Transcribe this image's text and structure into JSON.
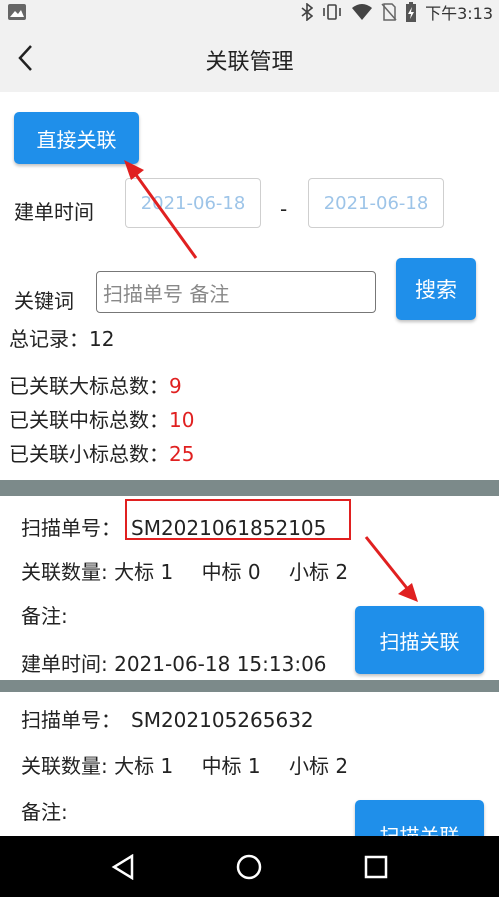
{
  "status_bar": {
    "time": "下午3:13",
    "icons": [
      "image-icon",
      "bluetooth-icon",
      "vibrate-icon",
      "wifi-icon",
      "no-sim-icon",
      "battery-icon"
    ]
  },
  "header": {
    "title": "关联管理",
    "back_icon": "chevron-left-icon"
  },
  "filter": {
    "direct_button": "直接关联",
    "date_label": "建单时间",
    "start_date": "2021-06-18",
    "date_separator": "-",
    "end_date": "2021-06-18",
    "keyword_label": "关键词",
    "keyword_placeholder": "扫描单号 备注",
    "search_button": "搜索"
  },
  "stats": {
    "total_label": "总记录：",
    "total_value": "12",
    "large_label": "已关联大标总数：",
    "large_value": "9",
    "medium_label": "已关联中标总数：",
    "medium_value": "10",
    "small_label": "已关联小标总数：",
    "small_value": "25"
  },
  "records": [
    {
      "order_label": "扫描单号：",
      "order_no": "SM2021061852105",
      "qty_label": "关联数量:",
      "large_label": "大标",
      "large_qty": "1",
      "medium_label": "中标",
      "medium_qty": "0",
      "small_label": "小标",
      "small_qty": "2",
      "note_label": "备注:",
      "time_label": "建单时间:",
      "time": "2021-06-18 15:13:06",
      "scan_button": "扫描关联"
    },
    {
      "order_label": "扫描单号：",
      "order_no": "SM202105265632",
      "qty_label": "关联数量:",
      "large_label": "大标",
      "large_qty": "1",
      "medium_label": "中标",
      "medium_qty": "1",
      "small_label": "小标",
      "small_qty": "2",
      "note_label": "备注:",
      "scan_button": "扫描关联"
    }
  ],
  "colors": {
    "primary": "#1f8fea",
    "highlight": "#e02020",
    "divider": "#7c8a8a"
  }
}
